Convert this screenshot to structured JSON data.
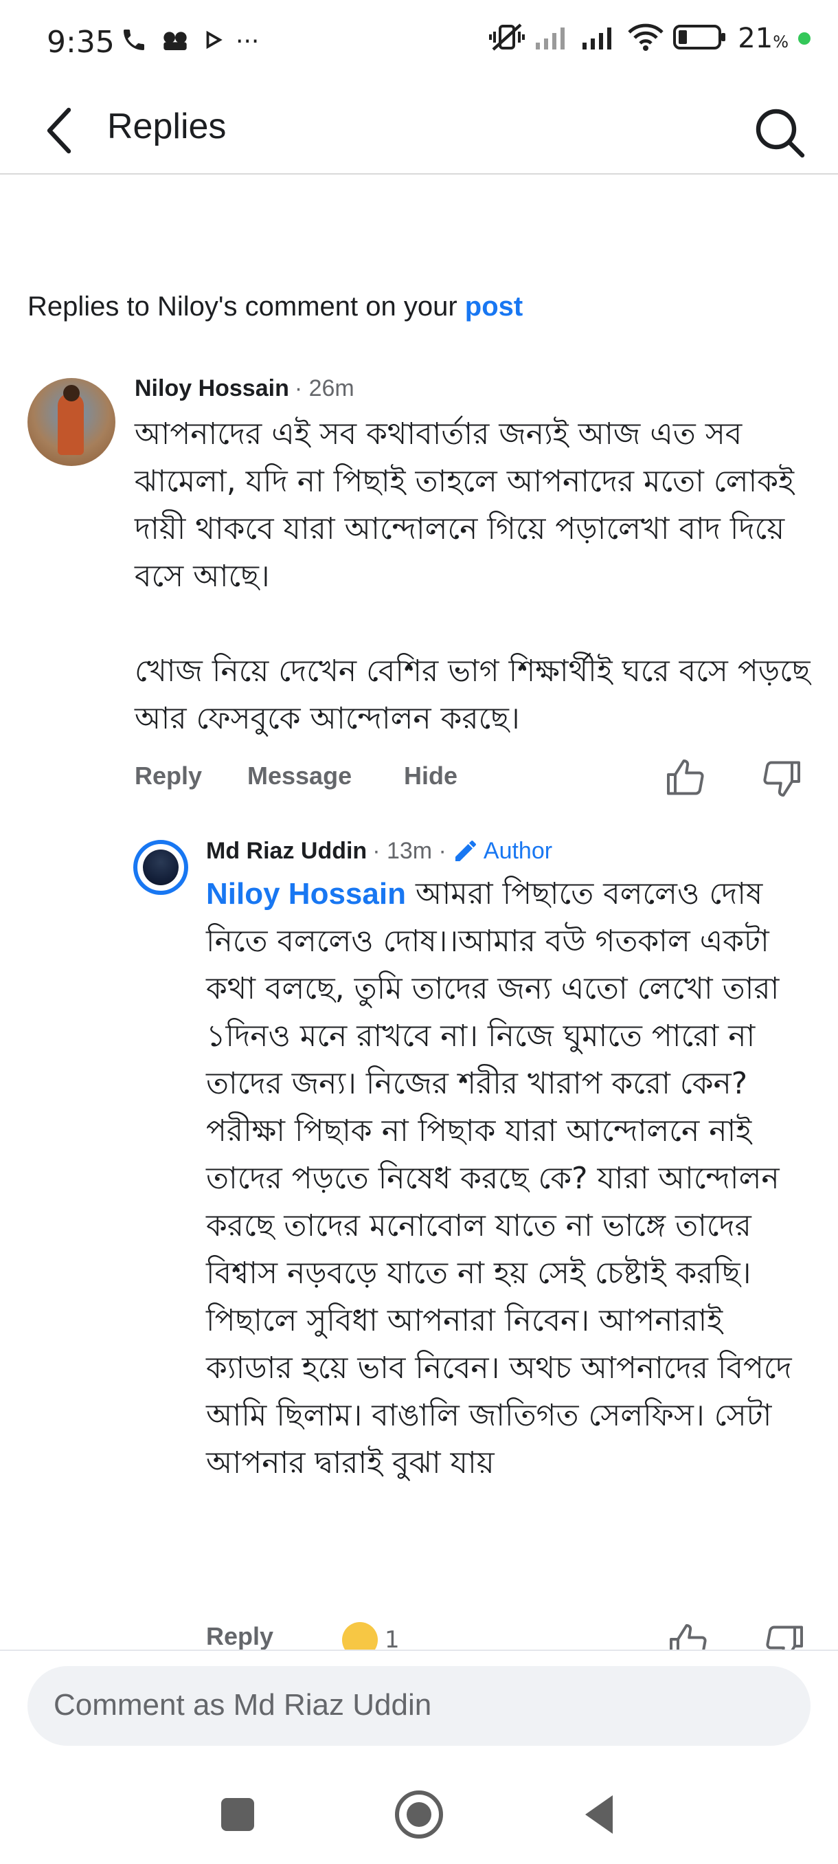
{
  "status_bar": {
    "time": "9:35",
    "left_icons": [
      "phone-icon",
      "voicemail-icon",
      "play-icon",
      "more-dots-icon"
    ],
    "right_icons": [
      "mute-vibrate-icon",
      "signal-icon",
      "signal-icon",
      "wifi-icon",
      "battery-icon"
    ],
    "battery": "21",
    "battery_unit": "%"
  },
  "header": {
    "title": "Replies",
    "back_icon": "back-arrow-icon",
    "search_icon": "search-icon"
  },
  "context": {
    "prefix": "Replies to Niloy's comment on your ",
    "link": "post"
  },
  "comments": [
    {
      "author": "Niloy Hossain",
      "time": "· 26m",
      "paragraph1": "আপনাদের এই সব কথাবার্তার জন্যই আজ এত সব ঝামেলা,  যদি না পিছাই তাহলে আপনাদের মতো লোকই দায়ী থাকবে যারা আন্দোলনে গিয়ে পড়ালেখা বাদ দিয়ে বসে আছে।",
      "paragraph2": "খোজ নিয়ে দেখেন বেশির ভাগ শিক্ষার্থীই ঘরে বসে পড়ছে আর ফেসবুকে আন্দোলন করছে।",
      "actions": {
        "reply": "Reply",
        "message": "Message",
        "hide": "Hide"
      }
    },
    {
      "author": "Md Riaz Uddin",
      "time": "· 13m ·",
      "badge": "Author",
      "mention": "Niloy Hossain",
      "text": " আমরা পিছাতে বললেও দোষ নিতে বললেও দোষ।।আমার বউ গতকাল একটা কথা বলছে, তুমি তাদের জন্য এতো লেখো তারা ১দিনও মনে রাখবে না। নিজে ঘুমাতে পারো না তাদের জন্য। নিজের শরীর খারাপ করো কেন?",
      "text2": "পরীক্ষা পিছাক না পিছাক যারা আন্দোলনে নাই তাদের পড়তে নিষেধ করছে কে? যারা আন্দোলন করছে তাদের মনোবোল যাতে না ভাঙ্গে তাদের বিশ্বাস নড়বড়ে যাতে না হয় সেই চেষ্টাই করছি। পিছালে সুবিধা আপনারা নিবেন। আপনারাই ক্যাডার হয়ে ভাব নিবেন। অথচ আপনাদের বিপদে আমি ছিলাম। বাঙালি জাতিগত সেলফিস। সেটা আপনার দ্বারাই বুঝা যায়",
      "actions": {
        "reply": "Reply"
      },
      "reaction_count": "1"
    }
  ],
  "composer": {
    "placeholder": "Comment as Md Riaz Uddin"
  },
  "nav": [
    "recents-square-icon",
    "home-circle-icon",
    "back-triangle-icon"
  ]
}
